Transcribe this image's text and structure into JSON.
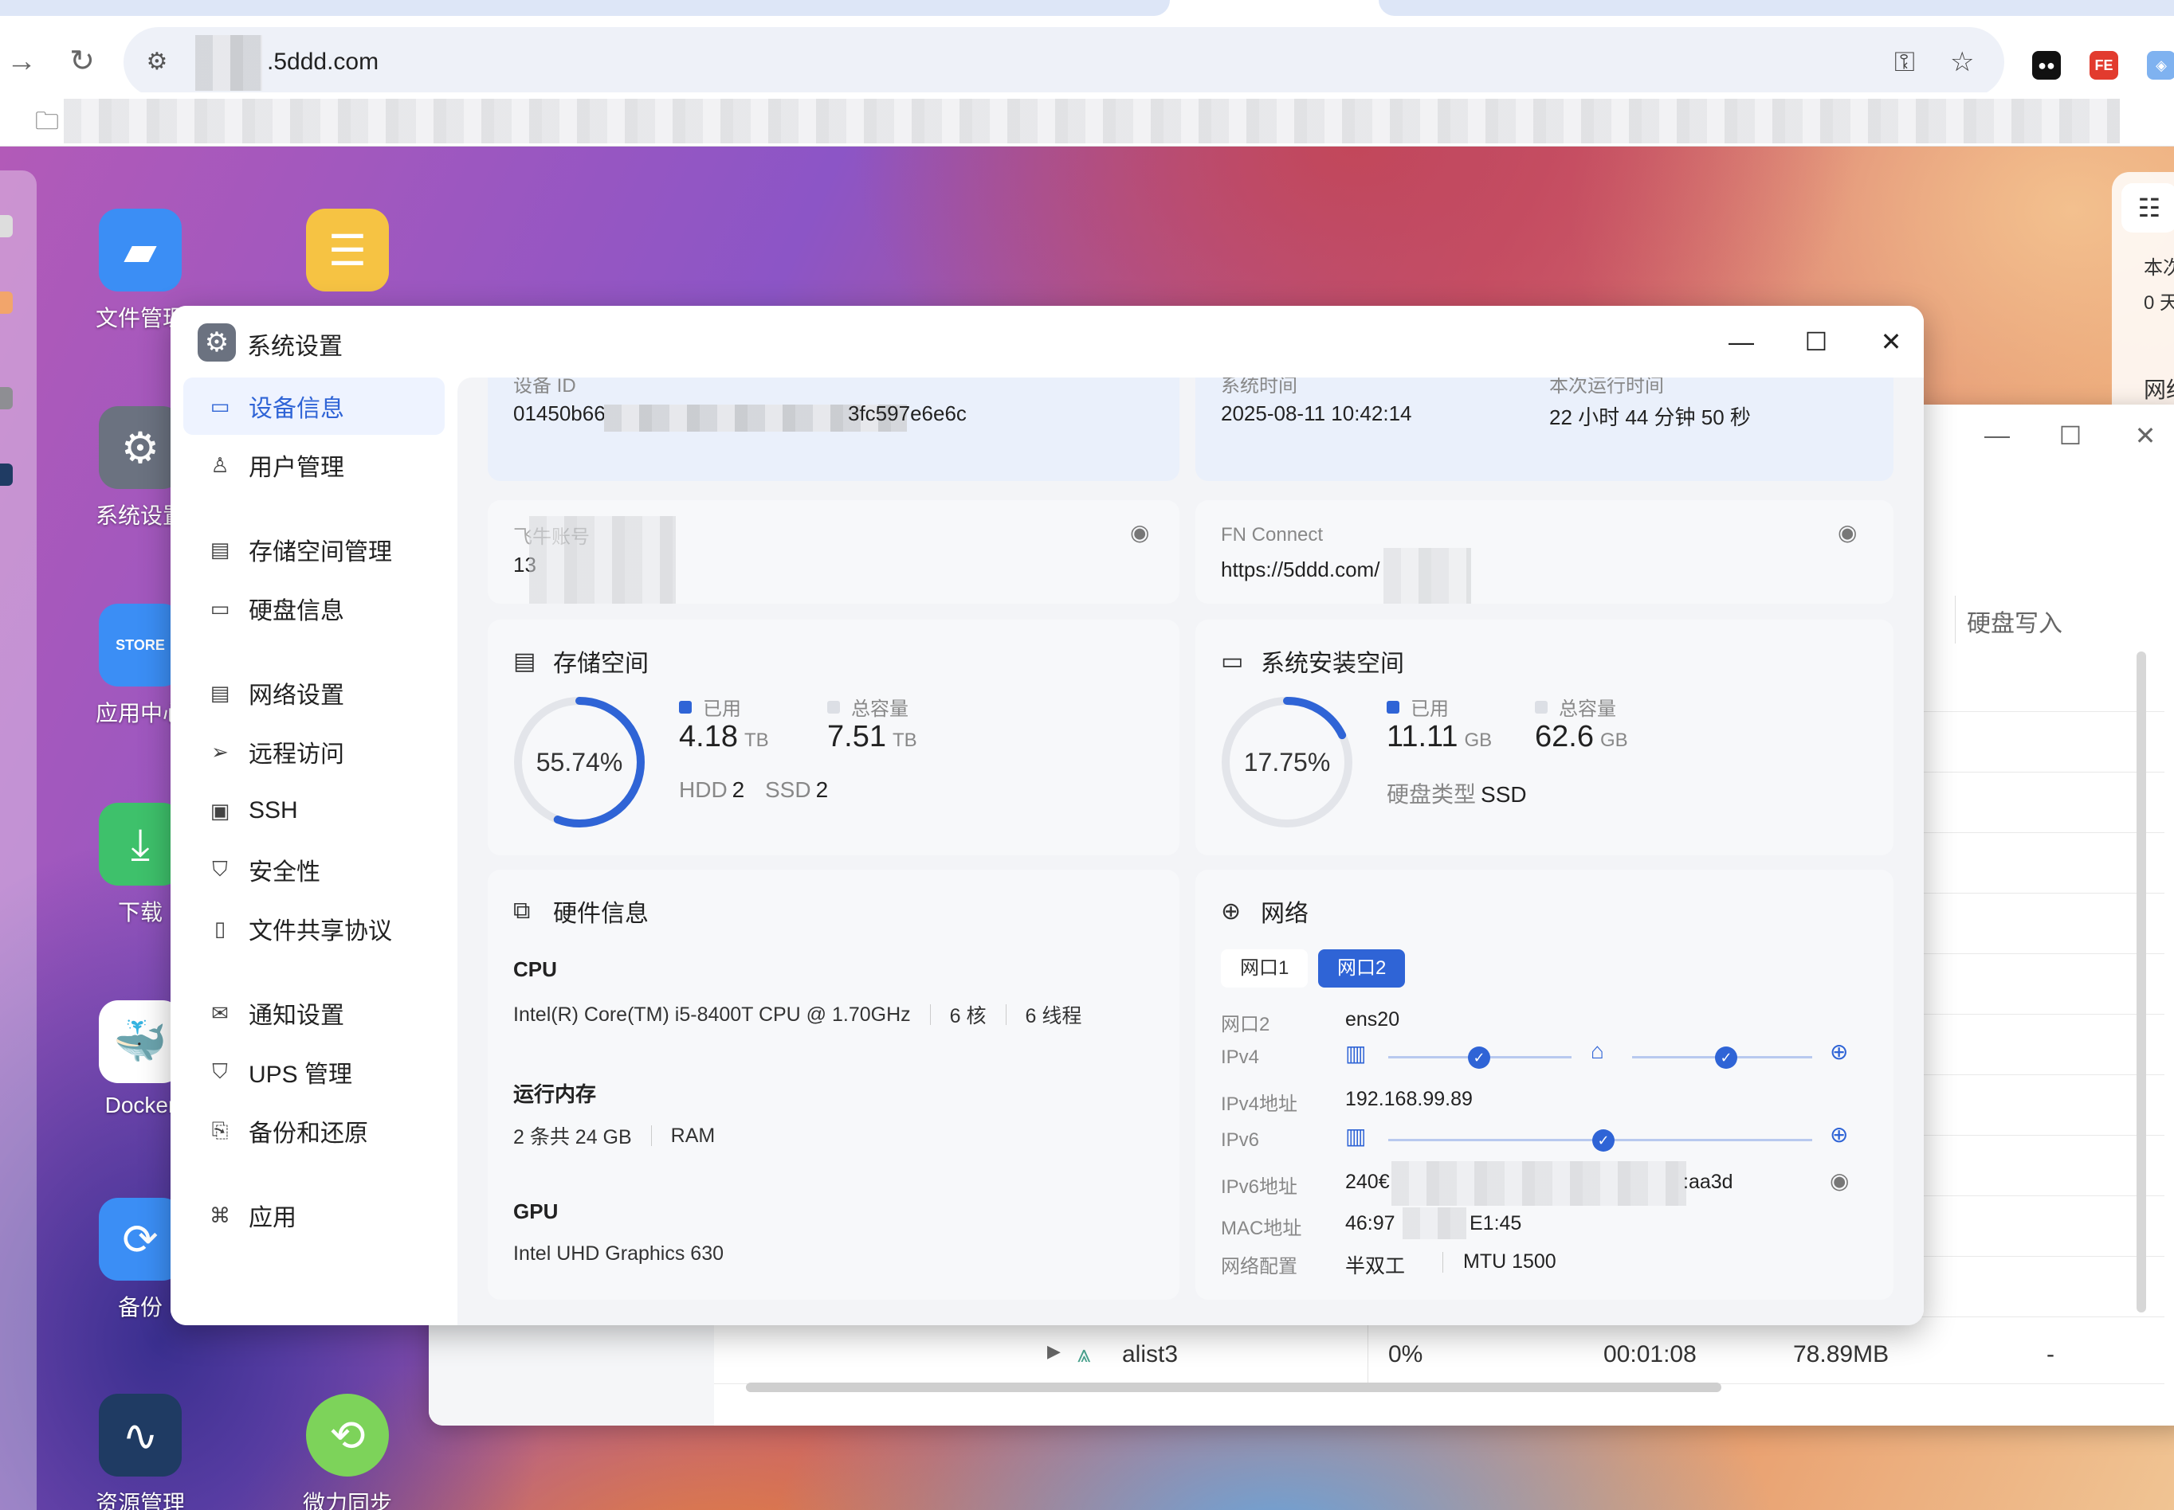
{
  "browser": {
    "url_suffix": ".5ddd.com",
    "key_icon": "key-icon",
    "star_icon": "star-icon"
  },
  "desktop_apps": [
    {
      "label": "文件管理",
      "icon": "folder-icon",
      "color": "#3b8ef5"
    },
    {
      "label": "系统设置",
      "icon": "gear-icon",
      "color": "#6b7280"
    },
    {
      "label": "应用中心",
      "icon": "store-icon",
      "color": "#3b8ef5"
    },
    {
      "label": "下载",
      "icon": "download-icon",
      "color": "#3ec16b"
    },
    {
      "label": "Docker",
      "icon": "docker-icon",
      "color": "#ffffff"
    },
    {
      "label": "备份",
      "icon": "sync-icon",
      "color": "#3b8ef5"
    },
    {
      "label": "资源管理",
      "icon": "monitor-icon",
      "color": "#1f3b63"
    },
    {
      "label": "微力同步",
      "icon": "verysync-icon",
      "color": "#7dd35a"
    }
  ],
  "widget": {
    "label1": "本次",
    "label2": "0 天",
    "label3": "网络"
  },
  "monitor": {
    "col_header": "硬盘写入",
    "dash": "-",
    "last_row": {
      "name": "alist3",
      "cpu": "0%",
      "time": "00:01:08",
      "mem": "78.89MB",
      "d1": "-",
      "d2": "-"
    }
  },
  "window": {
    "title": "系统设置",
    "minimize": "—",
    "maximize": "☐",
    "close": "✕"
  },
  "sidebar": {
    "items": [
      {
        "label": "设备信息",
        "active": true
      },
      {
        "label": "用户管理"
      },
      {
        "label": "存储空间管理"
      },
      {
        "label": "硬盘信息"
      },
      {
        "label": "网络设置"
      },
      {
        "label": "远程访问"
      },
      {
        "label": "SSH"
      },
      {
        "label": "安全性"
      },
      {
        "label": "文件共享协议"
      },
      {
        "label": "通知设置"
      },
      {
        "label": "UPS 管理"
      },
      {
        "label": "备份和还原"
      },
      {
        "label": "应用"
      }
    ]
  },
  "device": {
    "id_label": "设备 ID",
    "id_prefix": "01450b66",
    "id_suffix": "3fc597e6e6c",
    "time_label": "系统时间",
    "time_value": "2025-08-11 10:42:14",
    "uptime_label": "本次运行时间",
    "uptime_value": "22 小时 44 分钟 50 秒",
    "phone_label": "飞牛账号",
    "phone_value": "13",
    "fn_label": "FN Connect",
    "fn_value": "https://5ddd.com/"
  },
  "storage": {
    "title": "存储空间",
    "percent": "55.74%",
    "percent_value": 55.74,
    "used_label": "已用",
    "used_value": "4.18",
    "used_unit": "TB",
    "total_label": "总容量",
    "total_value": "7.51",
    "total_unit": "TB",
    "hdd_label": "HDD",
    "hdd_count": "2",
    "ssd_label": "SSD",
    "ssd_count": "2"
  },
  "system_space": {
    "title": "系统安装空间",
    "percent": "17.75%",
    "percent_value": 17.75,
    "used_label": "已用",
    "used_value": "11.11",
    "used_unit": "GB",
    "total_label": "总容量",
    "total_value": "62.6",
    "total_unit": "GB",
    "disk_type_label": "硬盘类型",
    "disk_type_value": "SSD"
  },
  "hardware": {
    "title": "硬件信息",
    "cpu_label": "CPU",
    "cpu_model": "Intel(R) Core(TM) i5-8400T CPU @ 1.70GHz",
    "cpu_cores": "6 核",
    "cpu_threads": "6 线程",
    "ram_label": "运行内存",
    "ram_value": "2 条共 24 GB",
    "ram_type": "RAM",
    "gpu_label": "GPU",
    "gpu_value": "Intel UHD Graphics 630"
  },
  "network": {
    "title": "网络",
    "tab1": "网口1",
    "tab2": "网口2",
    "iface_label": "网口2",
    "iface_value": "ens20",
    "ipv4_label": "IPv4",
    "ipv4addr_label": "IPv4地址",
    "ipv4addr_value": "192.168.99.89",
    "ipv6_label": "IPv6",
    "ipv6addr_label": "IPv6地址",
    "ipv6addr_prefix": "240€",
    "ipv6addr_suffix": ":aa3d",
    "mac_label": "MAC地址",
    "mac_prefix": "46:97",
    "mac_suffix": "E1:45",
    "config_label": "网络配置",
    "duplex": "半双工",
    "mtu": "MTU 1500"
  },
  "colors": {
    "accent": "#2f64d6",
    "ring_track": "#e3e5ea"
  }
}
